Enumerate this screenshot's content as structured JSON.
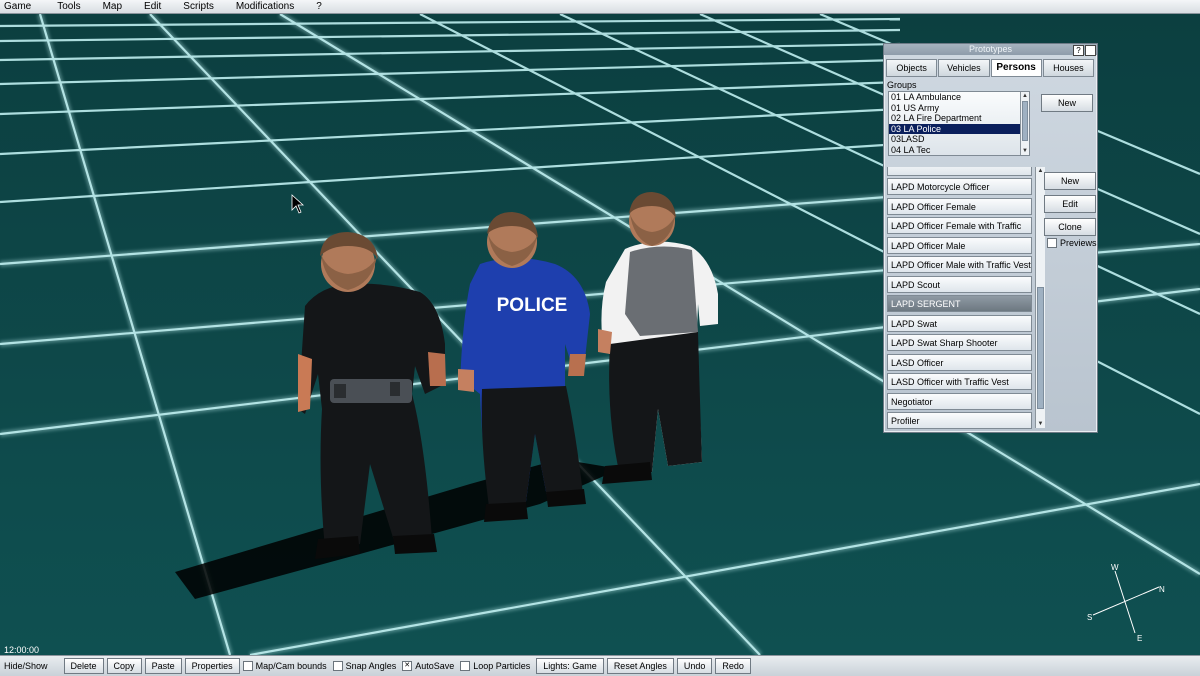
{
  "menu": [
    "Game",
    "Tools",
    "Map",
    "Edit",
    "Scripts",
    "Modifications",
    "?"
  ],
  "scene": {
    "clock": "12:00:00",
    "shirt_text": "POLICE"
  },
  "prototypes": {
    "title": "Prototypes",
    "help_glyph": "?",
    "tabs": [
      {
        "label": "Objects",
        "active": false
      },
      {
        "label": "Vehicles",
        "active": false
      },
      {
        "label": "Persons",
        "active": true
      },
      {
        "label": "Houses",
        "active": false
      }
    ],
    "groups_label": "Groups",
    "groups": [
      "01 LA Ambulance",
      "01 US Army",
      "02 LA Fire Department",
      "03 LA Police",
      "03LASD",
      "04 LA Tec"
    ],
    "selected_group": "03 LA Police",
    "group_new": "New",
    "persons": [
      "LAPD Motorcycle Officer",
      "LAPD Officer Female",
      "LAPD Officer Female with Traffic Vest",
      "LAPD Officer Male",
      "LAPD Officer Male with Traffic Vest",
      "LAPD Scout",
      "LAPD SERGENT",
      "LAPD Swat",
      "LAPD Swat Sharp Shooter",
      "LASD Officer",
      "LASD Officer with Traffic Vest",
      "Negotiator",
      "Profiler"
    ],
    "selected_person": "LAPD SERGENT",
    "buttons": {
      "new": "New",
      "edit": "Edit",
      "clone": "Clone"
    },
    "previews_label": "Previews",
    "previews_checked": false
  },
  "compass": {
    "n": "N",
    "e": "E",
    "s": "S",
    "w": "W"
  },
  "bottombar": {
    "hide_show": "Hide/Show",
    "delete": "Delete",
    "copy": "Copy",
    "paste": "Paste",
    "properties": "Properties",
    "map_cam_bounds": "Map/Cam bounds",
    "snap_angles": "Snap Angles",
    "autosave": "AutoSave",
    "loop_particles": "Loop Particles",
    "lights": "Lights: Game",
    "reset_angles": "Reset Angles",
    "undo": "Undo",
    "redo": "Redo",
    "autosave_checked": true
  },
  "colors": {
    "floor": "#0f4a4a",
    "grid": "#bfeff0",
    "selection": "#0a1f5c"
  }
}
